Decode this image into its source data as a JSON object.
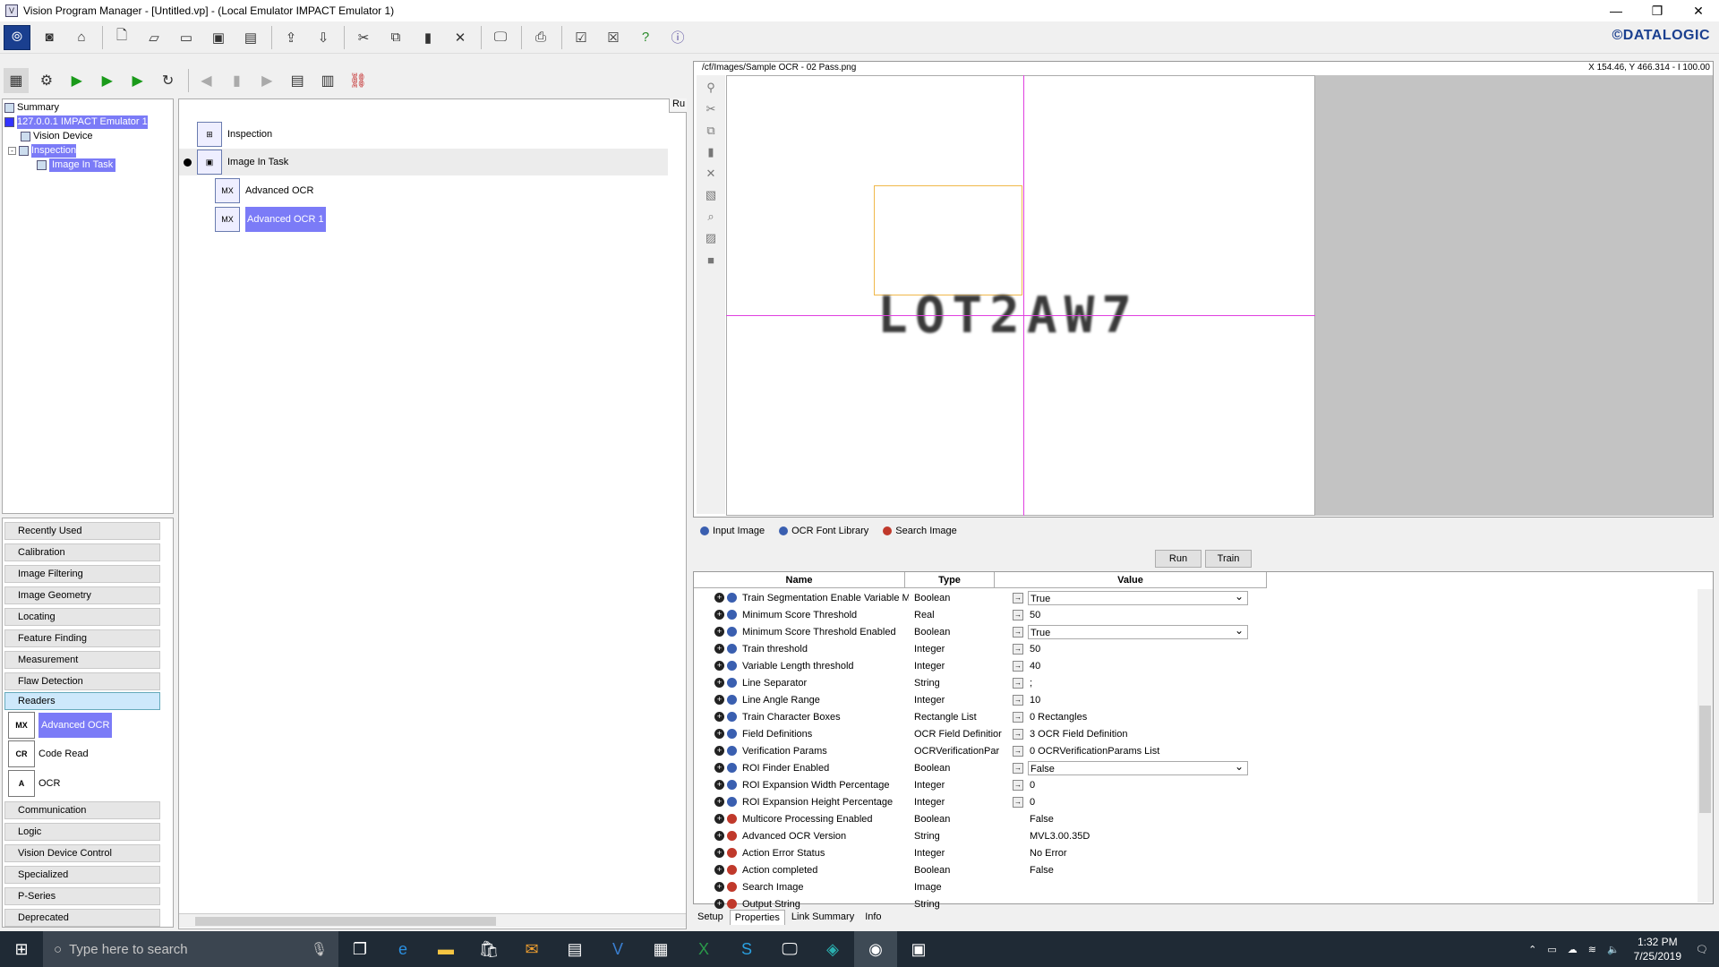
{
  "window": {
    "title": "Vision Program Manager - [Untitled.vp] - (Local Emulator IMPACT Emulator 1)",
    "app_icon": "V"
  },
  "brand": "©DATALOGIC",
  "tree": {
    "items": [
      {
        "label": "Summary"
      },
      {
        "label": "127.0.0.1 IMPACT Emulator 1"
      },
      {
        "label": "Vision Device"
      },
      {
        "label": "Inspection"
      },
      {
        "label": "Image In Task"
      }
    ]
  },
  "toolbox": {
    "categories": [
      "Recently Used",
      "Calibration",
      "Image Filtering",
      "Image Geometry",
      "Locating",
      "Feature Finding",
      "Measurement",
      "Flaw Detection",
      "Readers",
      "Communication",
      "Logic",
      "Vision Device Control",
      "Specialized",
      "P-Series",
      "Deprecated"
    ],
    "tools": [
      {
        "label": "Advanced OCR",
        "icon": "MX"
      },
      {
        "label": "Code Read",
        "icon": "CR"
      },
      {
        "label": "OCR",
        "icon": "A"
      }
    ]
  },
  "task": {
    "header": "Ru",
    "items": [
      {
        "label": "Inspection"
      },
      {
        "label": "Image In Task"
      },
      {
        "label": "Advanced OCR"
      },
      {
        "label": "Advanced OCR 1"
      }
    ]
  },
  "image_view": {
    "path": "/cf/Images/Sample OCR - 02 Pass.png",
    "coords": "X 154.46,  Y 466.314  -  I 100.00",
    "ocr_text": "LOT2AW7",
    "tabs": [
      {
        "label": "Input Image",
        "color": "#3a5fb0"
      },
      {
        "label": "OCR Font Library",
        "color": "#3a5fb0"
      },
      {
        "label": "Search Image",
        "color": "#c0392b"
      }
    ]
  },
  "buttons": {
    "run": "Run",
    "train": "Train"
  },
  "grid": {
    "headers": {
      "name": "Name",
      "type": "Type",
      "value": "Value"
    },
    "rows": [
      {
        "name": "Train Segmentation Enable Variable M",
        "type": "Boolean",
        "value": "True",
        "dropdown": true,
        "link": true,
        "color": "#3a5fb0"
      },
      {
        "name": "Minimum Score Threshold",
        "type": "Real",
        "value": "50",
        "dropdown": false,
        "link": true,
        "color": "#3a5fb0"
      },
      {
        "name": "Minimum Score Threshold Enabled",
        "type": "Boolean",
        "value": "True",
        "dropdown": true,
        "link": true,
        "color": "#3a5fb0"
      },
      {
        "name": "Train threshold",
        "type": "Integer",
        "value": "50",
        "dropdown": false,
        "link": true,
        "color": "#3a5fb0"
      },
      {
        "name": "Variable Length threshold",
        "type": "Integer",
        "value": "40",
        "dropdown": false,
        "link": true,
        "color": "#3a5fb0"
      },
      {
        "name": "Line Separator",
        "type": "String",
        "value": ";",
        "dropdown": false,
        "link": true,
        "color": "#3a5fb0"
      },
      {
        "name": "Line Angle Range",
        "type": "Integer",
        "value": "10",
        "dropdown": false,
        "link": true,
        "color": "#3a5fb0"
      },
      {
        "name": "Train Character Boxes",
        "type": "Rectangle List",
        "value": "0 Rectangles",
        "dropdown": false,
        "link": true,
        "color": "#3a5fb0"
      },
      {
        "name": "Field Definitions",
        "type": "OCR Field Definitior",
        "value": "3 OCR Field Definition",
        "dropdown": false,
        "link": true,
        "color": "#3a5fb0"
      },
      {
        "name": "Verification Params",
        "type": "OCRVerificationPar",
        "value": "0 OCRVerificationParams List",
        "dropdown": false,
        "link": true,
        "color": "#3a5fb0"
      },
      {
        "name": "ROI Finder Enabled",
        "type": "Boolean",
        "value": "False",
        "dropdown": true,
        "link": true,
        "color": "#3a5fb0"
      },
      {
        "name": "ROI Expansion Width Percentage",
        "type": "Integer",
        "value": "0",
        "dropdown": false,
        "link": true,
        "color": "#3a5fb0"
      },
      {
        "name": "ROI Expansion Height Percentage",
        "type": "Integer",
        "value": "0",
        "dropdown": false,
        "link": true,
        "color": "#3a5fb0"
      },
      {
        "name": "Multicore Processing Enabled",
        "type": "Boolean",
        "value": "False",
        "dropdown": false,
        "link": false,
        "color": "#c0392b"
      },
      {
        "name": "Advanced OCR Version",
        "type": "String",
        "value": "MVL3.00.35D",
        "dropdown": false,
        "link": false,
        "color": "#c0392b"
      },
      {
        "name": "Action Error Status",
        "type": "Integer",
        "value": "No Error",
        "dropdown": false,
        "link": false,
        "color": "#c0392b"
      },
      {
        "name": "Action completed",
        "type": "Boolean",
        "value": "False",
        "dropdown": false,
        "link": false,
        "color": "#c0392b"
      },
      {
        "name": "Search Image",
        "type": "Image",
        "value": "",
        "dropdown": false,
        "link": false,
        "color": "#c0392b"
      },
      {
        "name": "Output String",
        "type": "String",
        "value": "",
        "dropdown": false,
        "link": false,
        "color": "#c0392b"
      }
    ]
  },
  "bottom_tabs": [
    "Setup",
    "Properties",
    "Link Summary",
    "Info"
  ],
  "taskbar": {
    "search_placeholder": "Type here to search",
    "time": "1:32 PM",
    "date": "7/25/2019"
  }
}
